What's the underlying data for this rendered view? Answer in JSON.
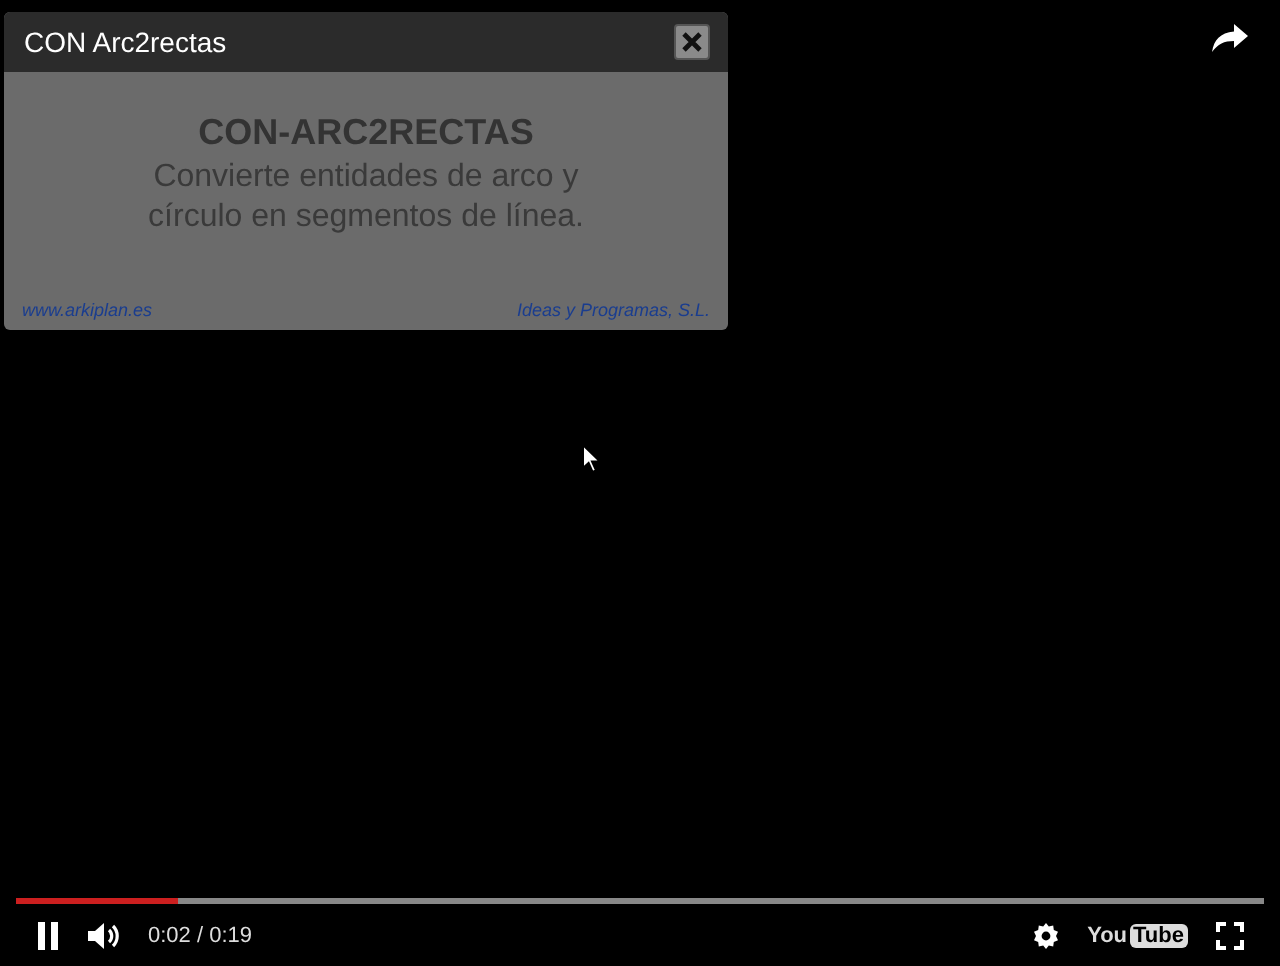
{
  "card": {
    "title": "CON Arc2rectas",
    "heading": "CON-ARC2RECTAS",
    "description": "Convierte entidades de arco y círculo en segmentos de línea.",
    "website": "www.arkiplan.es",
    "company": "Ideas y Programas, S.L."
  },
  "player": {
    "level": 0.13,
    "playing": true,
    "time": "0:02 / 0:19",
    "logo_left": "You",
    "logo_right": "Tube"
  }
}
